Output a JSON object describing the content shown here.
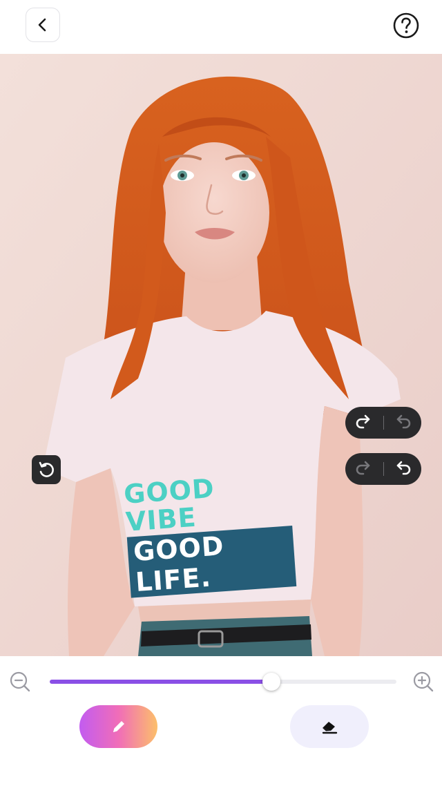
{
  "header": {
    "back_icon": "chevron-left-icon",
    "help_icon": "question-circle-icon"
  },
  "canvas": {
    "shirt_text_line1": "GOOD VIBE",
    "shirt_text_line2": "GOOD LIFE.",
    "controls": {
      "pill_top": {
        "left_icon": "redo-icon",
        "right_icon": "undo-icon",
        "active": "left"
      },
      "pill_bottom": {
        "left_icon": "redo-icon",
        "right_icon": "undo-icon",
        "active": "right"
      },
      "reset_icon": "reset-icon"
    }
  },
  "toolbar": {
    "zoom_out_icon": "zoom-out-icon",
    "zoom_in_icon": "zoom-in-icon",
    "slider_value": 0.64,
    "brush_icon": "pencil-icon",
    "eraser_icon": "eraser-icon"
  },
  "colors": {
    "accent": "#8a4fe6",
    "brush_gradient_start": "#c25cf0",
    "brush_gradient_end": "#fcbf6a",
    "eraser_bg": "#f0effc",
    "control_bg": "#2a2a2c"
  }
}
